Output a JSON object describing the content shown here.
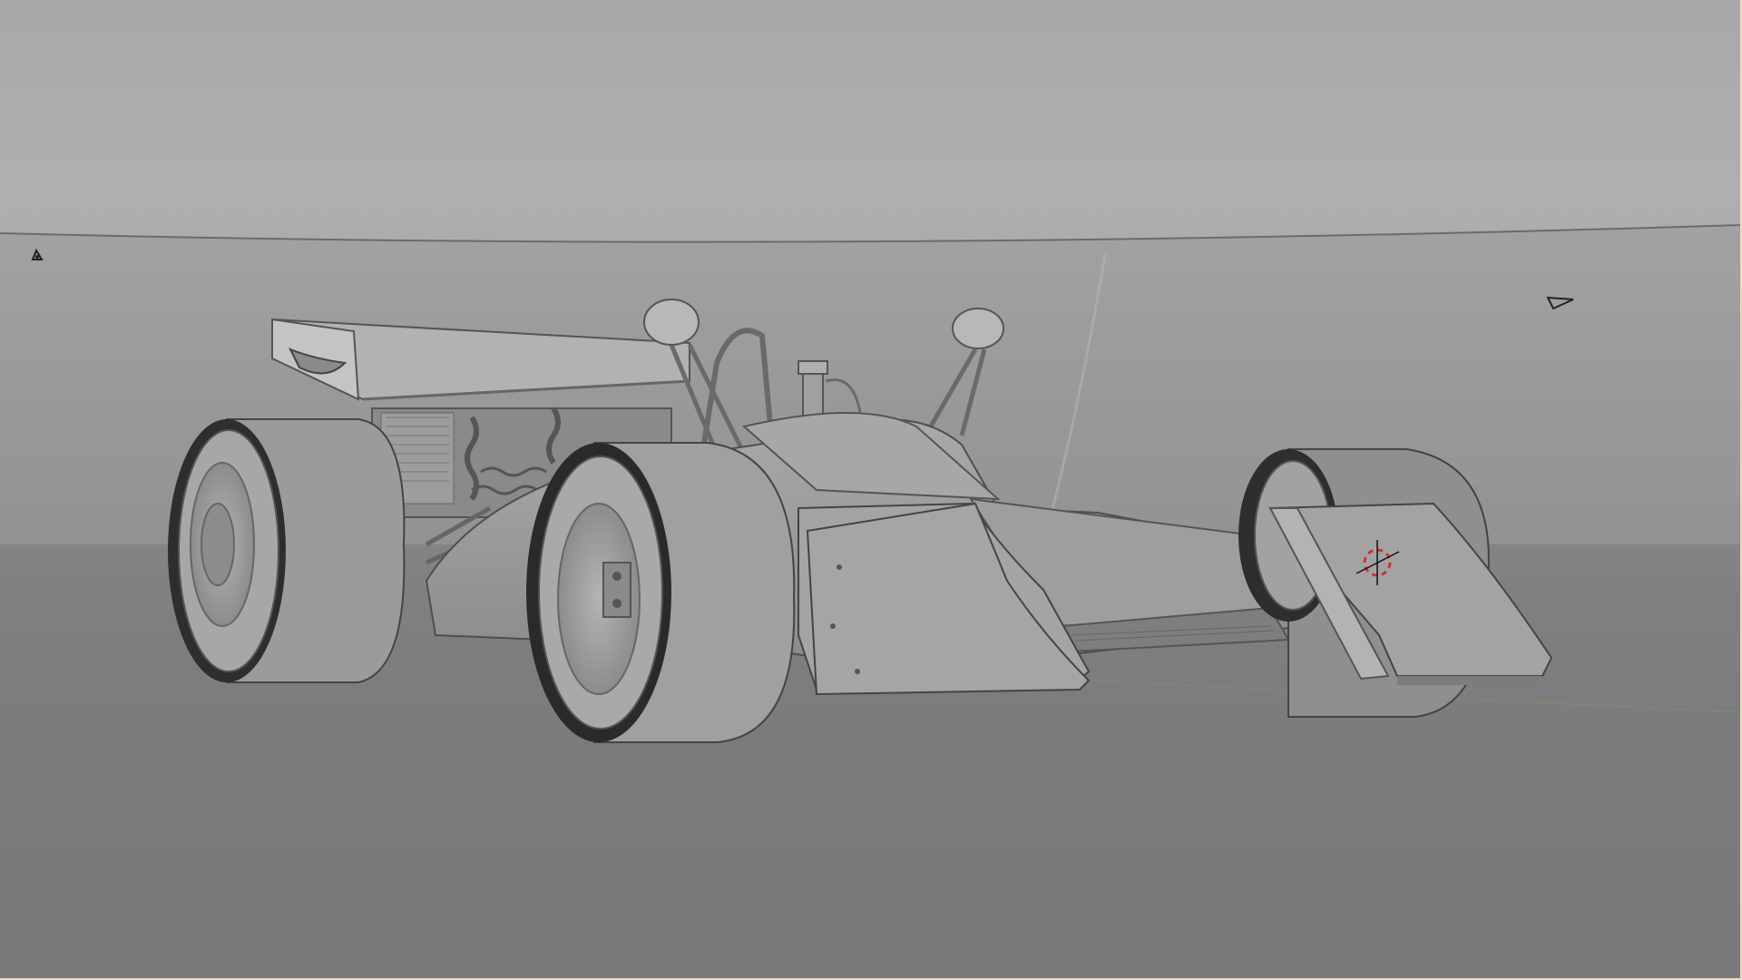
{
  "viewport": {
    "mode": "solid-shading",
    "subject": "formula-car-model",
    "colors": {
      "backdrop_top": "#b0b0b0",
      "backdrop_floor": "#646464",
      "model_surface": "#9a9a9a",
      "tire_dark": "#2a2a2a",
      "cursor_red": "#d23030",
      "frame_border": "#e7dfc2"
    }
  },
  "icons": {
    "cursor": "3d-cursor-icon",
    "light": "light-object-icon",
    "camera": "camera-object-icon"
  }
}
